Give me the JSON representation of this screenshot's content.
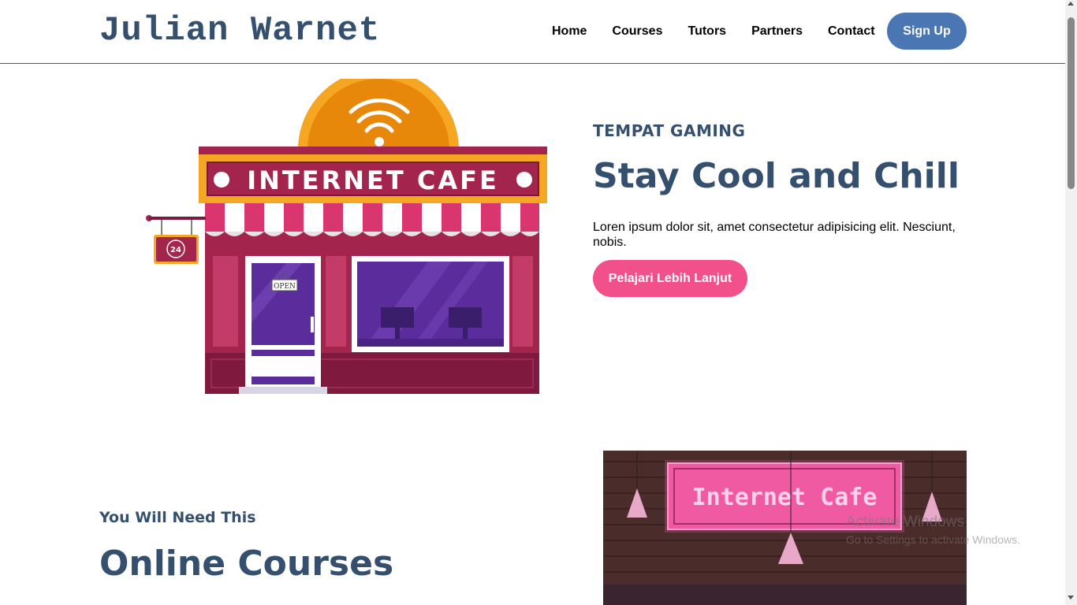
{
  "header": {
    "brand": "Julian Warnet",
    "nav": [
      "Home",
      "Courses",
      "Tutors",
      "Partners",
      "Contact"
    ],
    "signup_label": "Sign Up"
  },
  "hero": {
    "kicker": "TEMPAT GAMING",
    "title": "Stay Cool and Chill",
    "text": "Loren ipsum dolor sit, amet consectetur adipisicing elit. Nesciunt, nobis.",
    "cta_label": "Pelajari Lebih Lanjut",
    "illustration": {
      "sign_text": "INTERNET CAFE",
      "door_sign": "OPEN",
      "hours_sign": "24"
    }
  },
  "section2": {
    "kicker": "You Will Need This",
    "title": "Online Courses",
    "photo_sign": "Internet Cafe"
  },
  "watermark": {
    "line1": "Activate Windows",
    "line2": "Go to Settings to activate Windows."
  },
  "colors": {
    "primary_text": "#34506e",
    "signup_bg": "#4a76b4",
    "cta_bg": "#f2508a"
  }
}
